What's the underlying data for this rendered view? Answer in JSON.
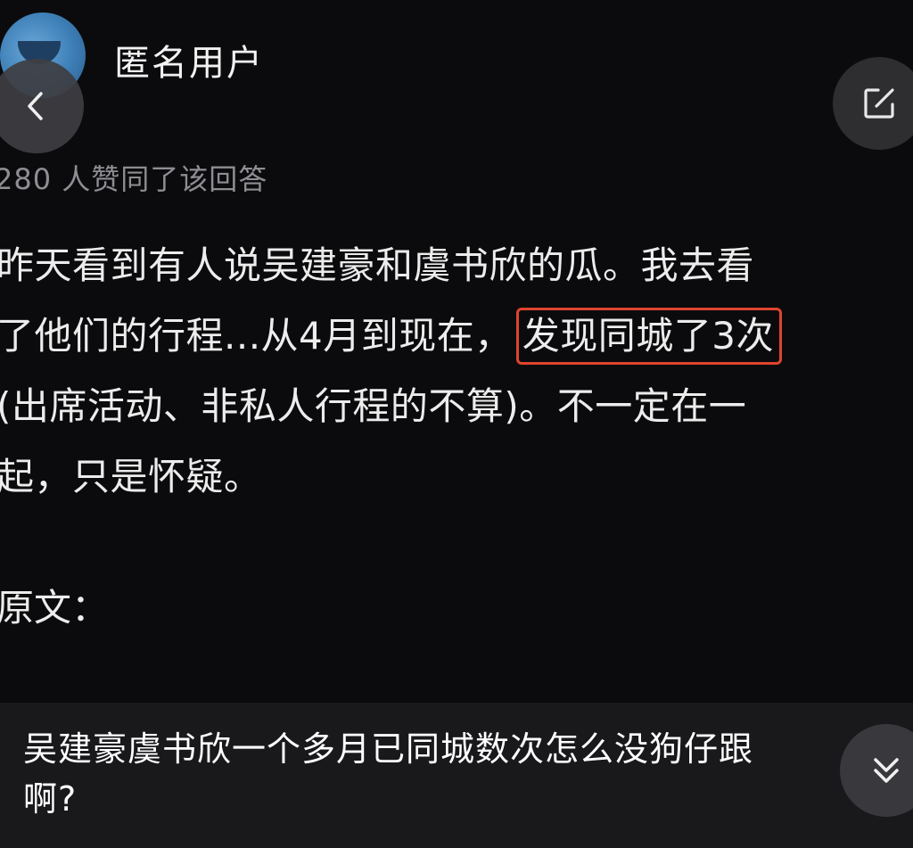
{
  "author": {
    "name": "匿名用户"
  },
  "answer": {
    "likes_text": "280 人赞同了该回答",
    "lines": [
      "昨天看到有人说吴建豪和虞书欣的瓜。我去看",
      "了他们的行程...从4月到现在，",
      "(出席活动、非私人行程的不算)。不一定在一",
      "起，只是怀疑。"
    ],
    "highlight": "发现同城了3次",
    "original_label": "原文："
  },
  "question": {
    "line1": "吴建豪虞书欣一个多月已同城数次怎么没狗仔跟",
    "line2": "啊?"
  },
  "icons": {
    "back": "chevron-left-icon",
    "edit": "edit-square-icon",
    "expand": "double-chevron-down-icon"
  },
  "colors": {
    "background": "#0b0b0d",
    "highlight_border": "#e0442e",
    "muted_text": "#8d8d92"
  }
}
